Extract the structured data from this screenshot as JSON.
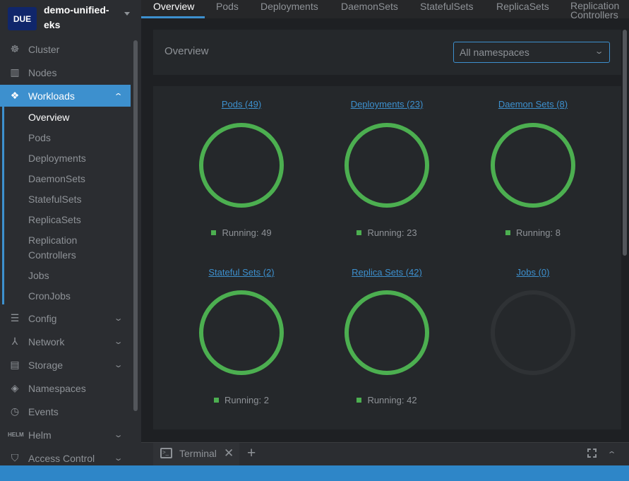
{
  "cluster": {
    "badge": "DUE",
    "name": "demo-unified-eks"
  },
  "sidebar": {
    "items": [
      {
        "label": "Cluster",
        "icon": "kubernetes-helm-wheel-icon"
      },
      {
        "label": "Nodes",
        "icon": "nodes-icon"
      },
      {
        "label": "Workloads",
        "icon": "workloads-cubes-icon",
        "expanded": true,
        "active": true
      },
      {
        "label": "Config",
        "icon": "list-icon"
      },
      {
        "label": "Network",
        "icon": "network-icon"
      },
      {
        "label": "Storage",
        "icon": "storage-icon"
      },
      {
        "label": "Namespaces",
        "icon": "layers-icon"
      },
      {
        "label": "Events",
        "icon": "clock-icon"
      },
      {
        "label": "Helm",
        "icon": "helm-icon"
      },
      {
        "label": "Access Control",
        "icon": "shield-icon"
      }
    ],
    "workloads_sub": [
      "Overview",
      "Pods",
      "Deployments",
      "DaemonSets",
      "StatefulSets",
      "ReplicaSets",
      "Replication Controllers",
      "Jobs",
      "CronJobs"
    ]
  },
  "tabs": [
    "Overview",
    "Pods",
    "Deployments",
    "DaemonSets",
    "StatefulSets",
    "ReplicaSets",
    "Replication Controllers"
  ],
  "overview": {
    "title": "Overview",
    "namespace_select": "All namespaces"
  },
  "workloads": [
    {
      "title": "Pods (49)",
      "running": "Running: 49",
      "status": "running"
    },
    {
      "title": "Deployments (23)",
      "running": "Running: 23",
      "status": "running"
    },
    {
      "title": "Daemon Sets (8)",
      "running": "Running: 8",
      "status": "running"
    },
    {
      "title": "Stateful Sets (2)",
      "running": "Running: 2",
      "status": "running"
    },
    {
      "title": "Replica Sets (42)",
      "running": "Running: 42",
      "status": "running"
    },
    {
      "title": "Jobs (0)",
      "running": "",
      "status": "empty"
    }
  ],
  "colors": {
    "accent": "#3d90ce",
    "running": "#4caf50",
    "empty": "#2f3235"
  },
  "terminal": {
    "tab_label": "Terminal"
  }
}
